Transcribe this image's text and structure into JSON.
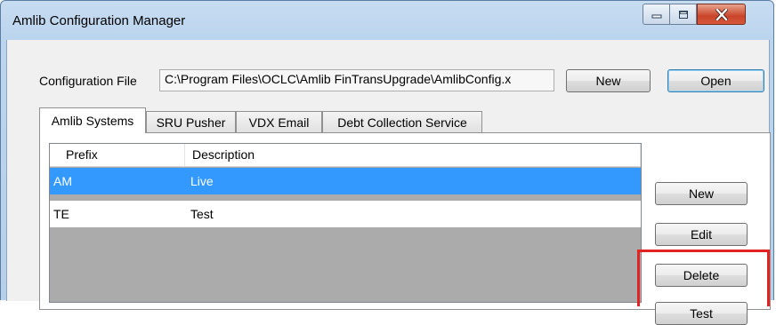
{
  "window": {
    "title": "Amlib Configuration Manager",
    "accent": "#3399ff",
    "close_color": "#c9442a"
  },
  "config_file": {
    "label": "Configuration File",
    "value": "C:\\Program Files\\OCLC\\Amlib FinTransUpgrade\\AmlibConfig.x",
    "new_label": "New",
    "open_label": "Open"
  },
  "tabs": [
    {
      "label": "Amlib Systems",
      "selected": true
    },
    {
      "label": "SRU Pusher",
      "selected": false
    },
    {
      "label": "VDX Email",
      "selected": false
    },
    {
      "label": "Debt Collection Service",
      "selected": false
    }
  ],
  "list": {
    "columns": [
      "Prefix",
      "Description"
    ],
    "rows": [
      {
        "prefix": "AM",
        "description": "Live",
        "selected": true
      },
      {
        "prefix": "TE",
        "description": "Test",
        "selected": false
      }
    ]
  },
  "side_buttons": {
    "new_label": "New",
    "edit_label": "Edit",
    "delete_label": "Delete",
    "test_label": "Test"
  },
  "annotation": {
    "color": "#e32222"
  }
}
